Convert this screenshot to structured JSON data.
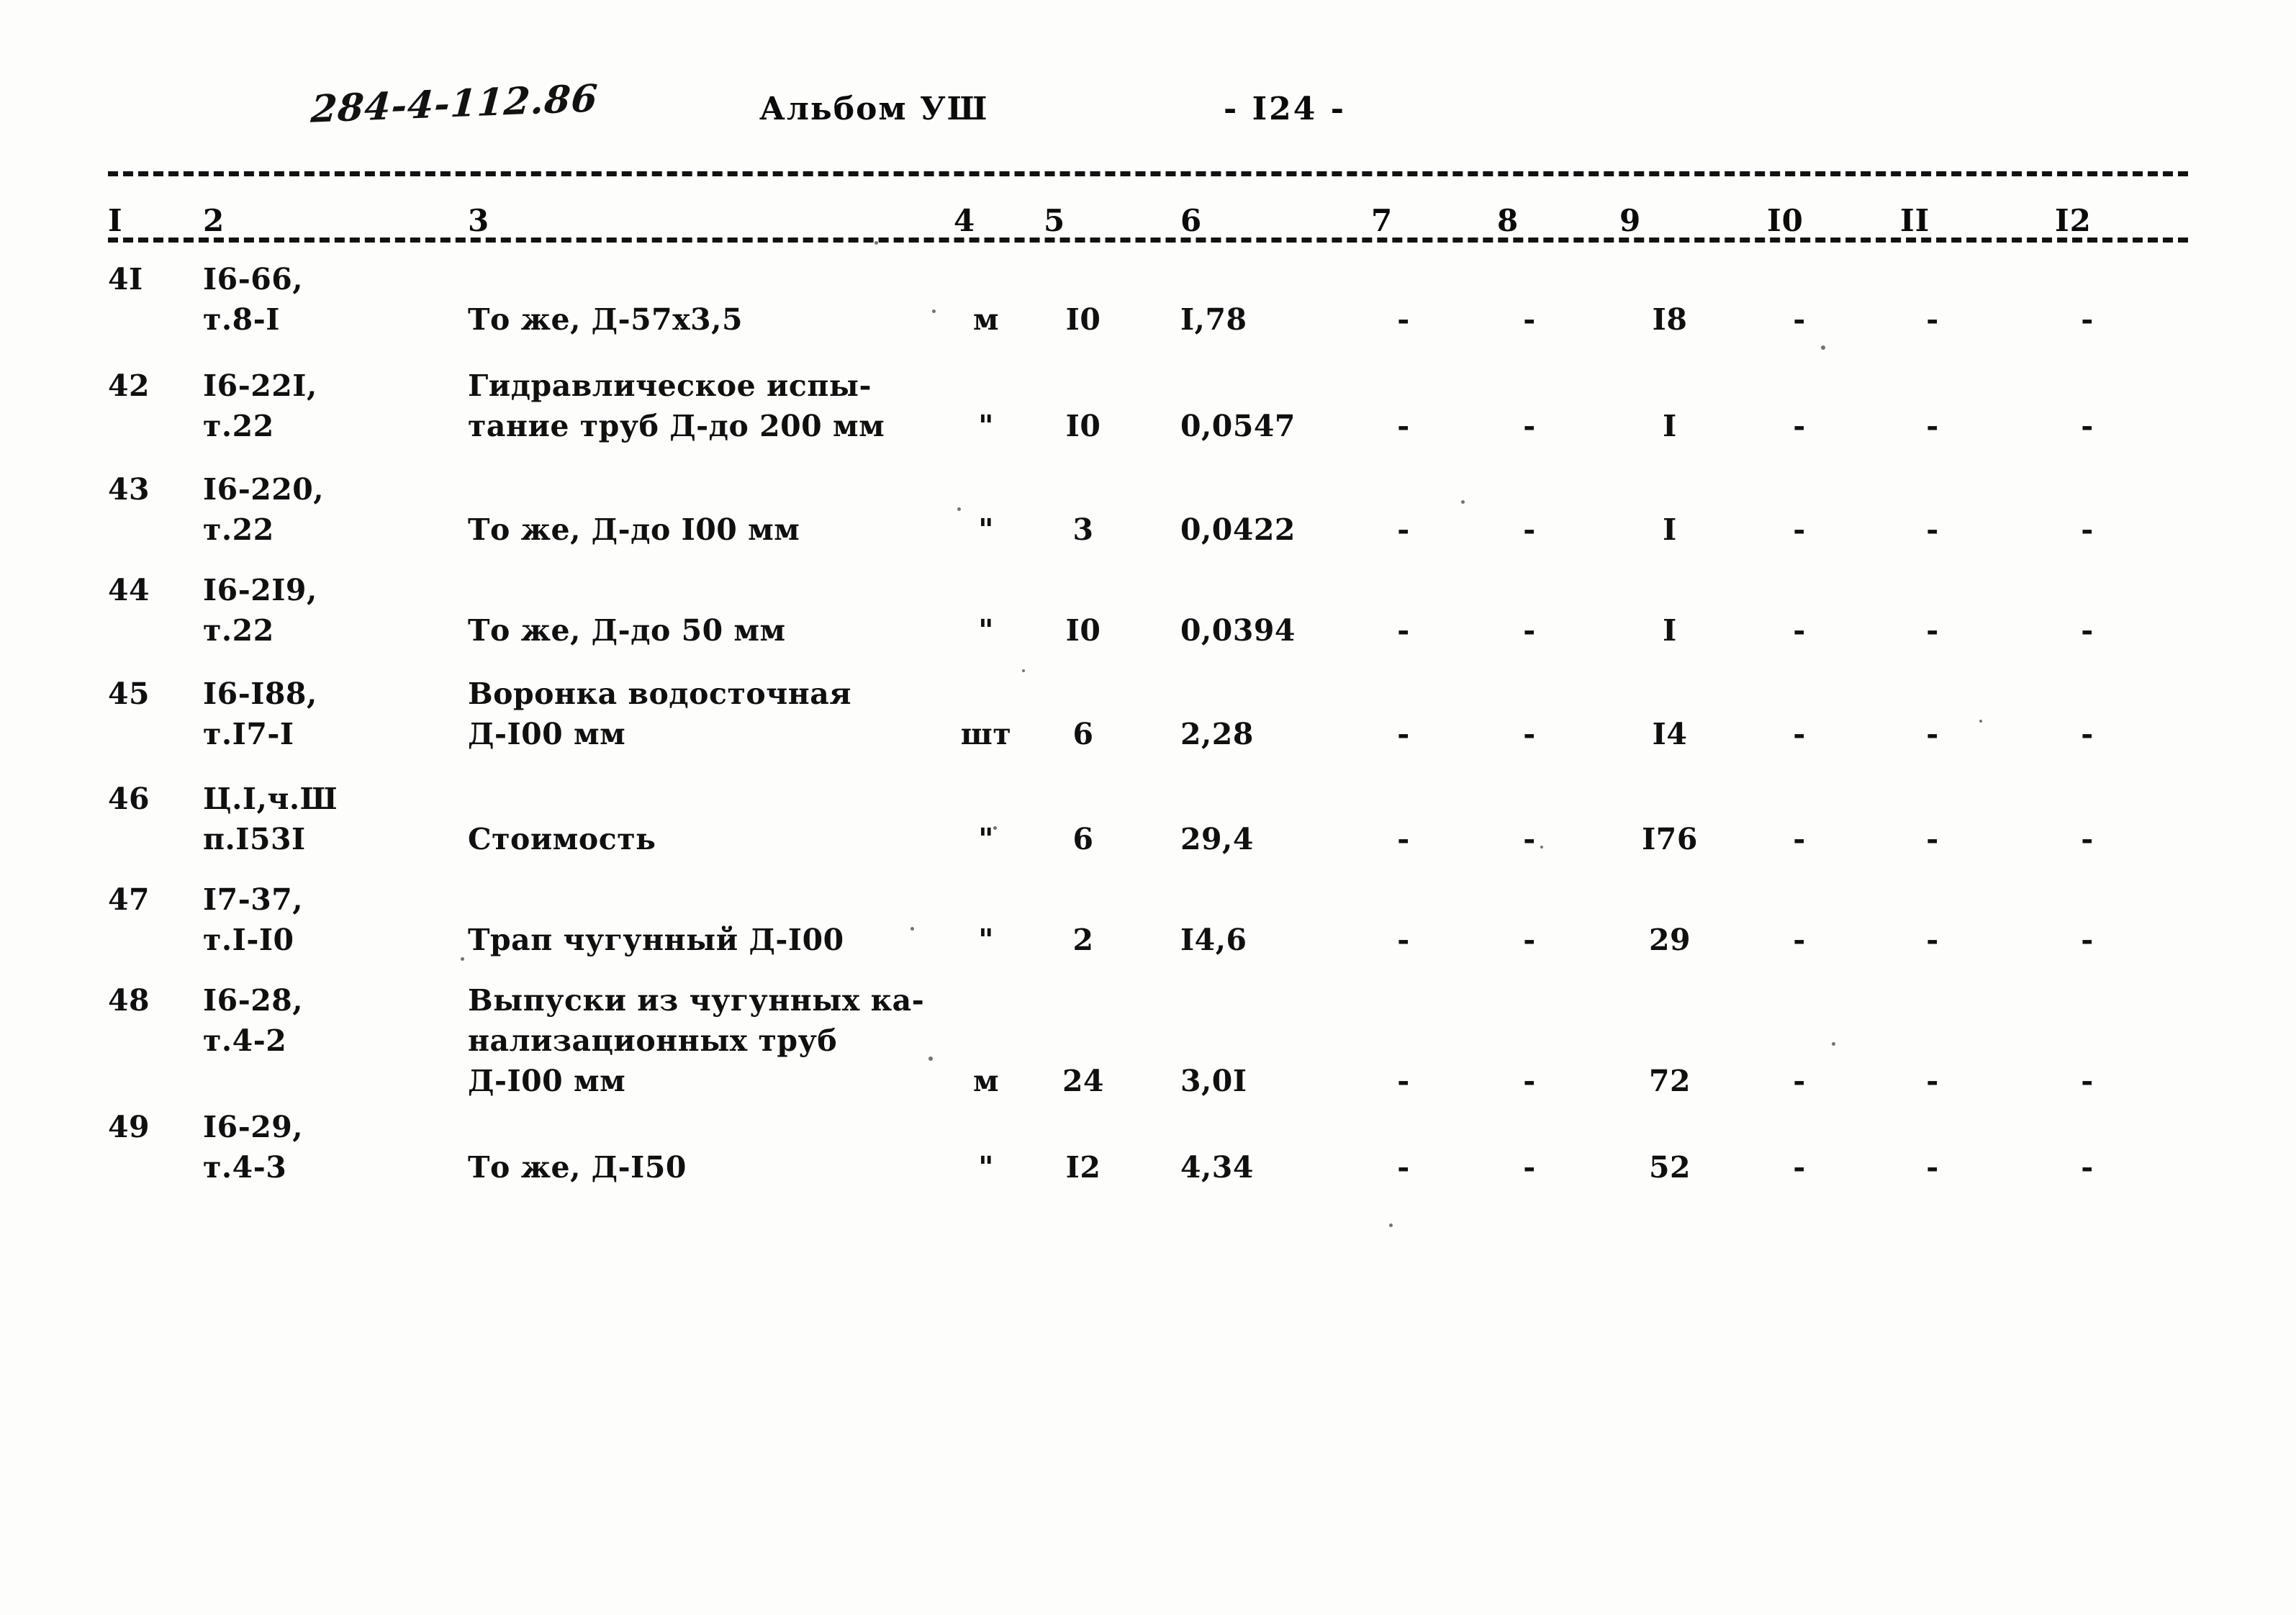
{
  "header": {
    "doc_code": "284-4-112.86",
    "album": "Альбом УШ",
    "page_label": "- I24 -"
  },
  "table": {
    "column_numbers": [
      "I",
      "2",
      "3",
      "4",
      "5",
      "6",
      "7",
      "8",
      "9",
      "I0",
      "II",
      "I2"
    ],
    "rows": [
      {
        "num": "4I",
        "code": "I6-66,\nт.8-I",
        "name": "То же, Д-57х3,5",
        "unit": "м",
        "qty": "I0",
        "v6": "I,78",
        "v7": "-",
        "v8": "-",
        "v9": "I8",
        "v10": "-",
        "v11": "-",
        "v12": "-"
      },
      {
        "num": "42",
        "code": "I6-22I,\nт.22",
        "name": "Гидравлическое испы-\nтание труб Д-до 200 мм",
        "unit": "\"",
        "qty": "I0",
        "v6": "0,0547",
        "v7": "-",
        "v8": "-",
        "v9": "I",
        "v10": "-",
        "v11": "-",
        "v12": "-"
      },
      {
        "num": "43",
        "code": "I6-220,\nт.22",
        "name": "То же, Д-до I00 мм",
        "unit": "\"",
        "qty": "3",
        "v6": "0,0422",
        "v7": "-",
        "v8": "-",
        "v9": "I",
        "v10": "-",
        "v11": "-",
        "v12": "-"
      },
      {
        "num": "44",
        "code": "I6-2I9,\nт.22",
        "name": "То же, Д-до 50 мм",
        "unit": "\"",
        "qty": "I0",
        "v6": "0,0394",
        "v7": "-",
        "v8": "-",
        "v9": "I",
        "v10": "-",
        "v11": "-",
        "v12": "-"
      },
      {
        "num": "45",
        "code": "I6-I88,\nт.I7-I",
        "name": "Воронка водосточная\nД-I00 мм",
        "unit": "шт",
        "qty": "6",
        "v6": "2,28",
        "v7": "-",
        "v8": "-",
        "v9": "I4",
        "v10": "-",
        "v11": "-",
        "v12": "-"
      },
      {
        "num": "46",
        "code": "Ц.I,ч.Ш\nп.I53I",
        "name": "Стоимость",
        "unit": "\"",
        "qty": "6",
        "v6": "29,4",
        "v7": "-",
        "v8": "-",
        "v9": "I76",
        "v10": "-",
        "v11": "-",
        "v12": "-"
      },
      {
        "num": "47",
        "code": "I7-37,\nт.I-I0",
        "name": "Трап чугунный Д-I00",
        "unit": "\"",
        "qty": "2",
        "v6": "I4,6",
        "v7": "-",
        "v8": "-",
        "v9": "29",
        "v10": "-",
        "v11": "-",
        "v12": "-"
      },
      {
        "num": "48",
        "code": "I6-28,\nт.4-2",
        "name": "Выпуски из чугунных ка-\nнализационных труб\nД-I00 мм",
        "unit": "м",
        "qty": "24",
        "v6": "3,0I",
        "v7": "-",
        "v8": "-",
        "v9": "72",
        "v10": "-",
        "v11": "-",
        "v12": "-"
      },
      {
        "num": "49",
        "code": "I6-29,\nт.4-3",
        "name": "То же, Д-I50",
        "unit": "\"",
        "qty": "I2",
        "v6": "4,34",
        "v7": "-",
        "v8": "-",
        "v9": "52",
        "v10": "-",
        "v11": "-",
        "v12": "-"
      }
    ]
  }
}
